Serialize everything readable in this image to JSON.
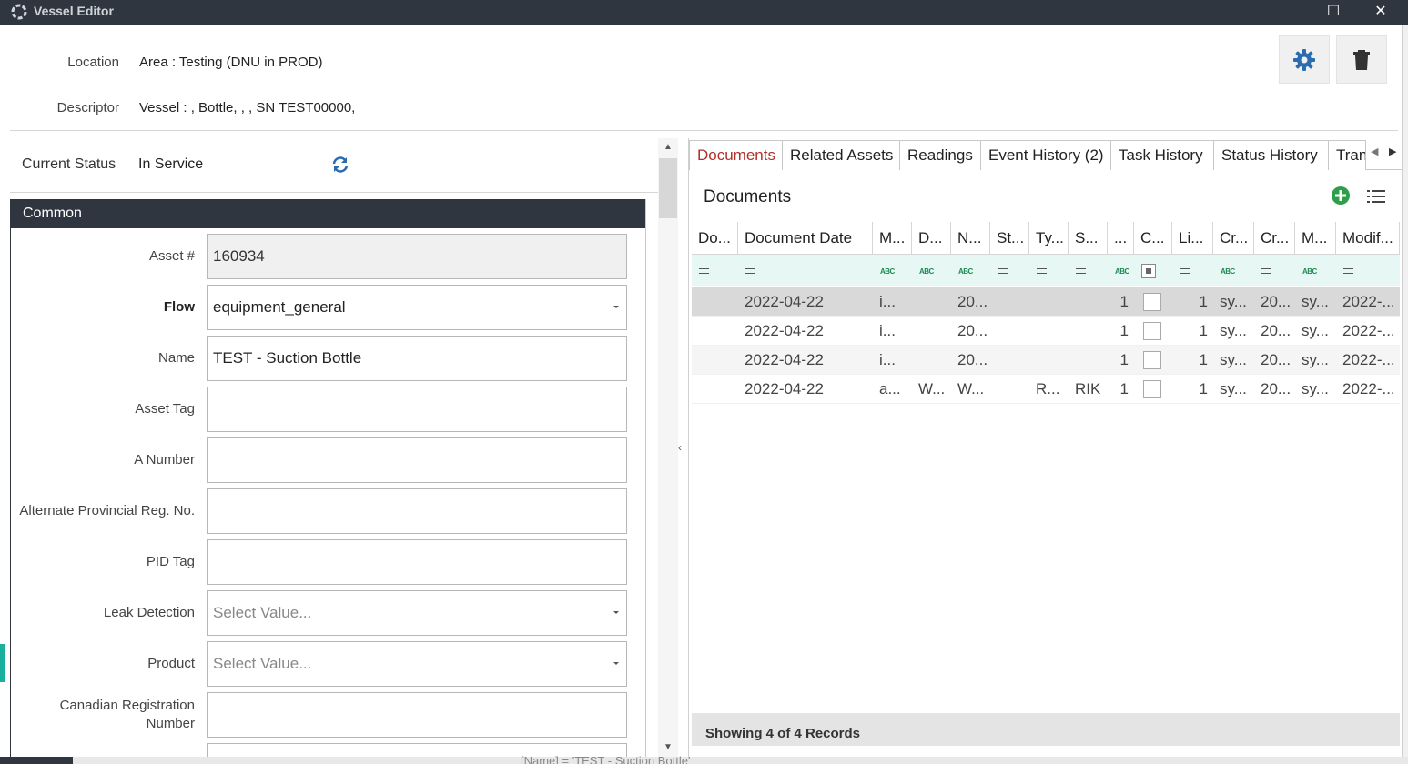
{
  "window": {
    "title": "Vessel Editor",
    "maximize_glyph": "☐",
    "close_glyph": "✕"
  },
  "header": {
    "location_label": "Location",
    "location_value": "Area : Testing (DNU in PROD)",
    "descriptor_label": "Descriptor",
    "descriptor_value": "Vessel : , Bottle, , , SN TEST00000,",
    "settings_icon": "gear-icon",
    "delete_icon": "trash-icon"
  },
  "status": {
    "label": "Current Status",
    "value": "In Service",
    "refresh_icon": "refresh-icon"
  },
  "common": {
    "section_title": "Common",
    "fields": [
      {
        "label": "Asset #",
        "value": "160934",
        "placeholder": ""
      },
      {
        "label": "Flow",
        "value": "equipment_general",
        "placeholder": ""
      },
      {
        "label": "Name",
        "value": "TEST - Suction Bottle",
        "placeholder": ""
      },
      {
        "label": "Asset Tag",
        "value": "",
        "placeholder": ""
      },
      {
        "label": "A Number",
        "value": "",
        "placeholder": ""
      },
      {
        "label": "Alternate Provincial Reg. No.",
        "value": "",
        "placeholder": ""
      },
      {
        "label": "PID Tag",
        "value": "",
        "placeholder": ""
      },
      {
        "label": "Leak Detection",
        "value": "",
        "placeholder": "Select Value..."
      },
      {
        "label": "Product",
        "value": "",
        "placeholder": "Select Value..."
      },
      {
        "label": "Canadian Registration",
        "label_line2": "Number",
        "value": "",
        "placeholder": ""
      }
    ]
  },
  "tabs": [
    {
      "label": "Documents",
      "active": true
    },
    {
      "label": "Related Assets",
      "active": false
    },
    {
      "label": "Readings",
      "active": false
    },
    {
      "label": "Event History (2)",
      "active": false
    },
    {
      "label": "Task History",
      "active": false
    },
    {
      "label": "Status History",
      "active": false
    },
    {
      "label": "Tran",
      "active": false
    }
  ],
  "documents": {
    "title": "Documents",
    "add_icon": "plus-circle-icon",
    "list_icon": "list-icon",
    "columns": [
      "Do...",
      "Document Date",
      "M...",
      "D...",
      "N...",
      "St...",
      "Ty...",
      "S...",
      "...",
      "C...",
      "Li...",
      "Cr...",
      "Cr...",
      "M...",
      "Modif..."
    ],
    "filter_types": [
      "eq",
      "eq",
      "abc",
      "abc",
      "abc",
      "eq",
      "eq",
      "eq",
      "abc",
      "check",
      "eq",
      "abc",
      "eq",
      "abc",
      "eq"
    ],
    "rows": [
      {
        "cells": [
          "",
          "2022-04-22",
          "i...",
          "",
          "20...",
          "",
          "",
          "",
          "1",
          "",
          "1",
          "sy...",
          "20...",
          "sy...",
          "2022-..."
        ],
        "checked": false
      },
      {
        "cells": [
          "",
          "2022-04-22",
          "i...",
          "",
          "20...",
          "",
          "",
          "",
          "1",
          "",
          "1",
          "sy...",
          "20...",
          "sy...",
          "2022-..."
        ],
        "checked": false
      },
      {
        "cells": [
          "",
          "2022-04-22",
          "i...",
          "",
          "20...",
          "",
          "",
          "",
          "1",
          "",
          "1",
          "sy...",
          "20...",
          "sy...",
          "2022-..."
        ],
        "checked": false
      },
      {
        "cells": [
          "",
          "2022-04-22",
          "a...",
          "W...",
          "W...",
          "",
          "R...",
          "RIK",
          "1",
          "",
          "1",
          "sy...",
          "20...",
          "sy...",
          "2022-..."
        ],
        "checked": false
      }
    ],
    "footer": "Showing 4 of 4 Records"
  },
  "colors": {
    "titlebar": "#2f3640",
    "active_tab": "#b0302a",
    "icon_blue": "#2b6cb0",
    "add_green": "#2e9e4a",
    "filter_bg": "#e7f7f3"
  },
  "bottom_status_text": "[Name] = 'TEST - Suction Bottle'"
}
